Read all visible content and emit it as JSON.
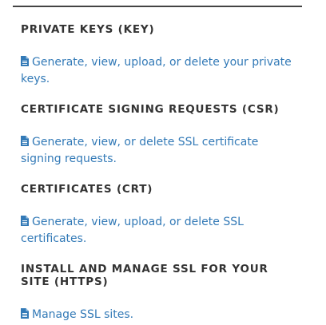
{
  "sections": [
    {
      "heading": "PRIVATE KEYS (KEY)",
      "link_text": "Generate, view, upload, or delete your private keys.",
      "icon": "document-icon"
    },
    {
      "heading": "CERTIFICATE SIGNING REQUESTS (CSR)",
      "link_text": "Generate, view, or delete SSL certificate signing requests.",
      "icon": "document-icon"
    },
    {
      "heading": "CERTIFICATES (CRT)",
      "link_text": "Generate, view, upload, or delete SSL certificates.",
      "icon": "document-icon"
    },
    {
      "heading": "INSTALL AND MANAGE SSL FOR YOUR SITE (HTTPS)",
      "link_text": "Manage SSL sites.",
      "icon": "document-icon"
    }
  ],
  "colors": {
    "link": "#337ab7",
    "heading": "#333333",
    "rule": "#444444"
  }
}
